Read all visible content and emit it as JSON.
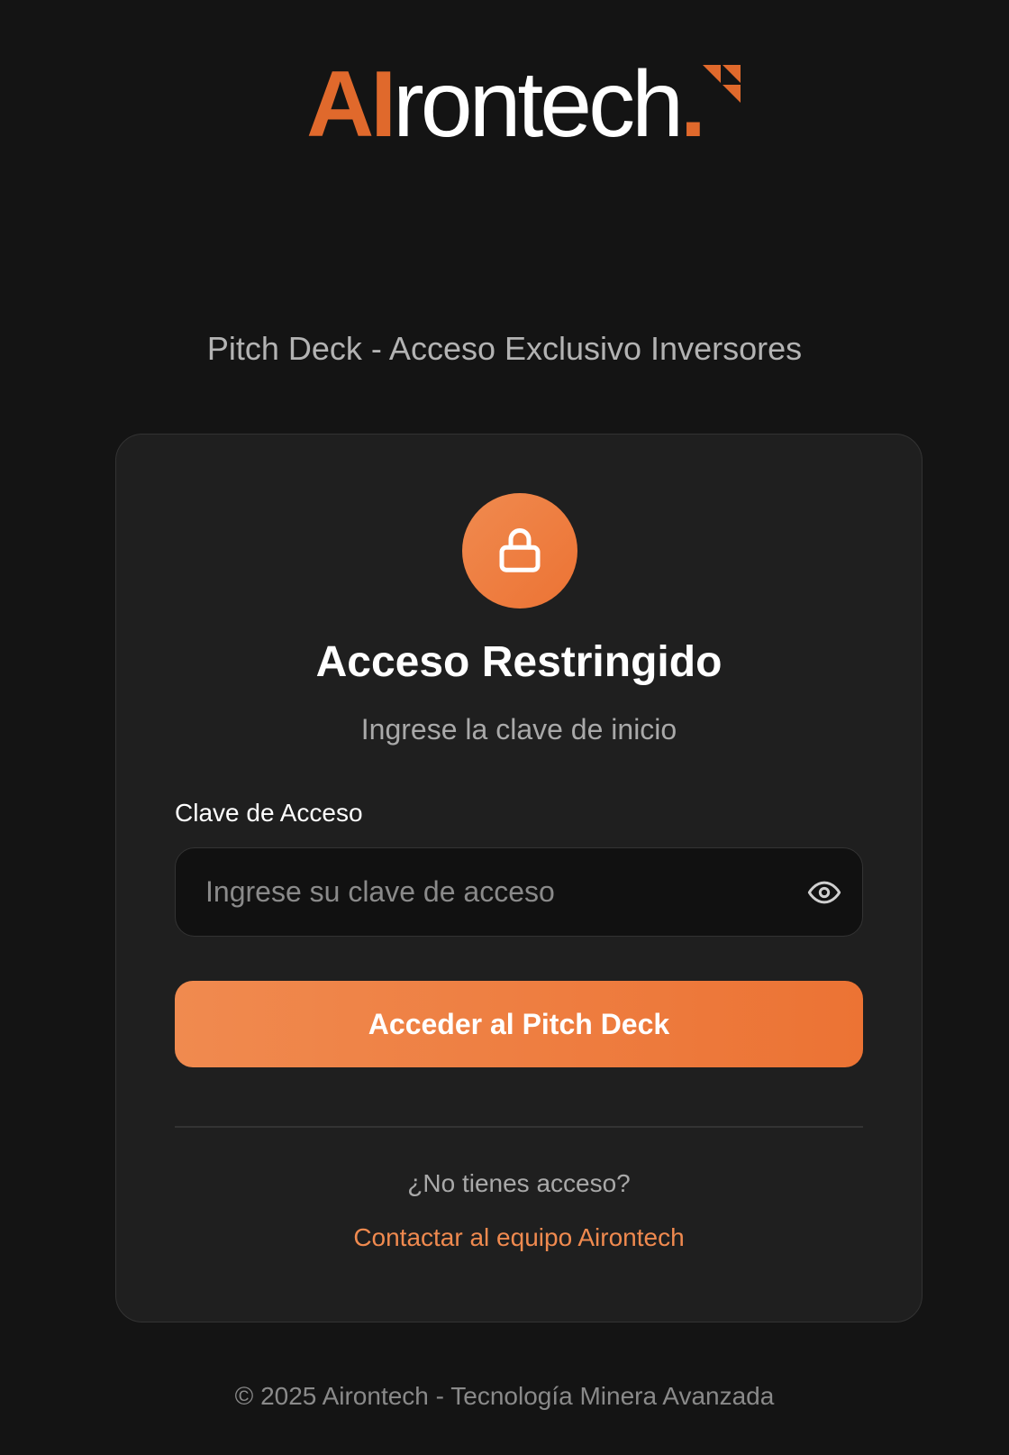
{
  "brand": {
    "logo_ai": "AI",
    "logo_rest": "rontech",
    "logo_dot": ".",
    "accent_color": "#e0692c"
  },
  "header": {
    "subtitle": "Pitch Deck - Acceso Exclusivo Inversores"
  },
  "card": {
    "icon": "lock-icon",
    "title": "Acceso Restringido",
    "subtitle": "Ingrese la clave de inicio",
    "field_label": "Clave de Acceso",
    "password_placeholder": "Ingrese su clave de acceso",
    "password_value": "",
    "toggle_icon": "eye-icon",
    "submit_label": "Acceder al Pitch Deck",
    "no_access_text": "¿No tienes acceso?",
    "contact_link": "Contactar al equipo Airontech"
  },
  "footer": {
    "text": "© 2025 Airontech - Tecnología Minera Avanzada"
  },
  "colors": {
    "background": "#141414",
    "card_bg": "#1f1f1f",
    "accent_start": "#f08a4f",
    "accent_end": "#ec7334"
  }
}
